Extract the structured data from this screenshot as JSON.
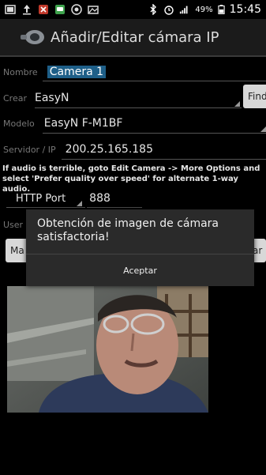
{
  "status": {
    "battery": "49%",
    "time": "15:45"
  },
  "app": {
    "title": "Añadir/Editar cámara IP"
  },
  "form": {
    "name_label": "Nombre",
    "name_value": "Camera 1",
    "make_label": "Crear",
    "make_value": "EasyN",
    "find_label": "Find",
    "model_label": "Modelo",
    "model_value": "EasyN F-M1BF",
    "server_label": "Servidor / IP",
    "server_value": "200.25.165.185",
    "audio_hint": "If audio is terrible, goto Edit Camera -> More Options and select 'Prefer quality over speed' for alternate 1-way audio.",
    "port_type": "HTTP Port",
    "port_value": "888",
    "user_label": "User",
    "btn_left_label": "Ma",
    "btn_right_label": "ar"
  },
  "dialog": {
    "message": "Obtención de imagen de cámara satisfactoria!",
    "accept": "Aceptar"
  }
}
